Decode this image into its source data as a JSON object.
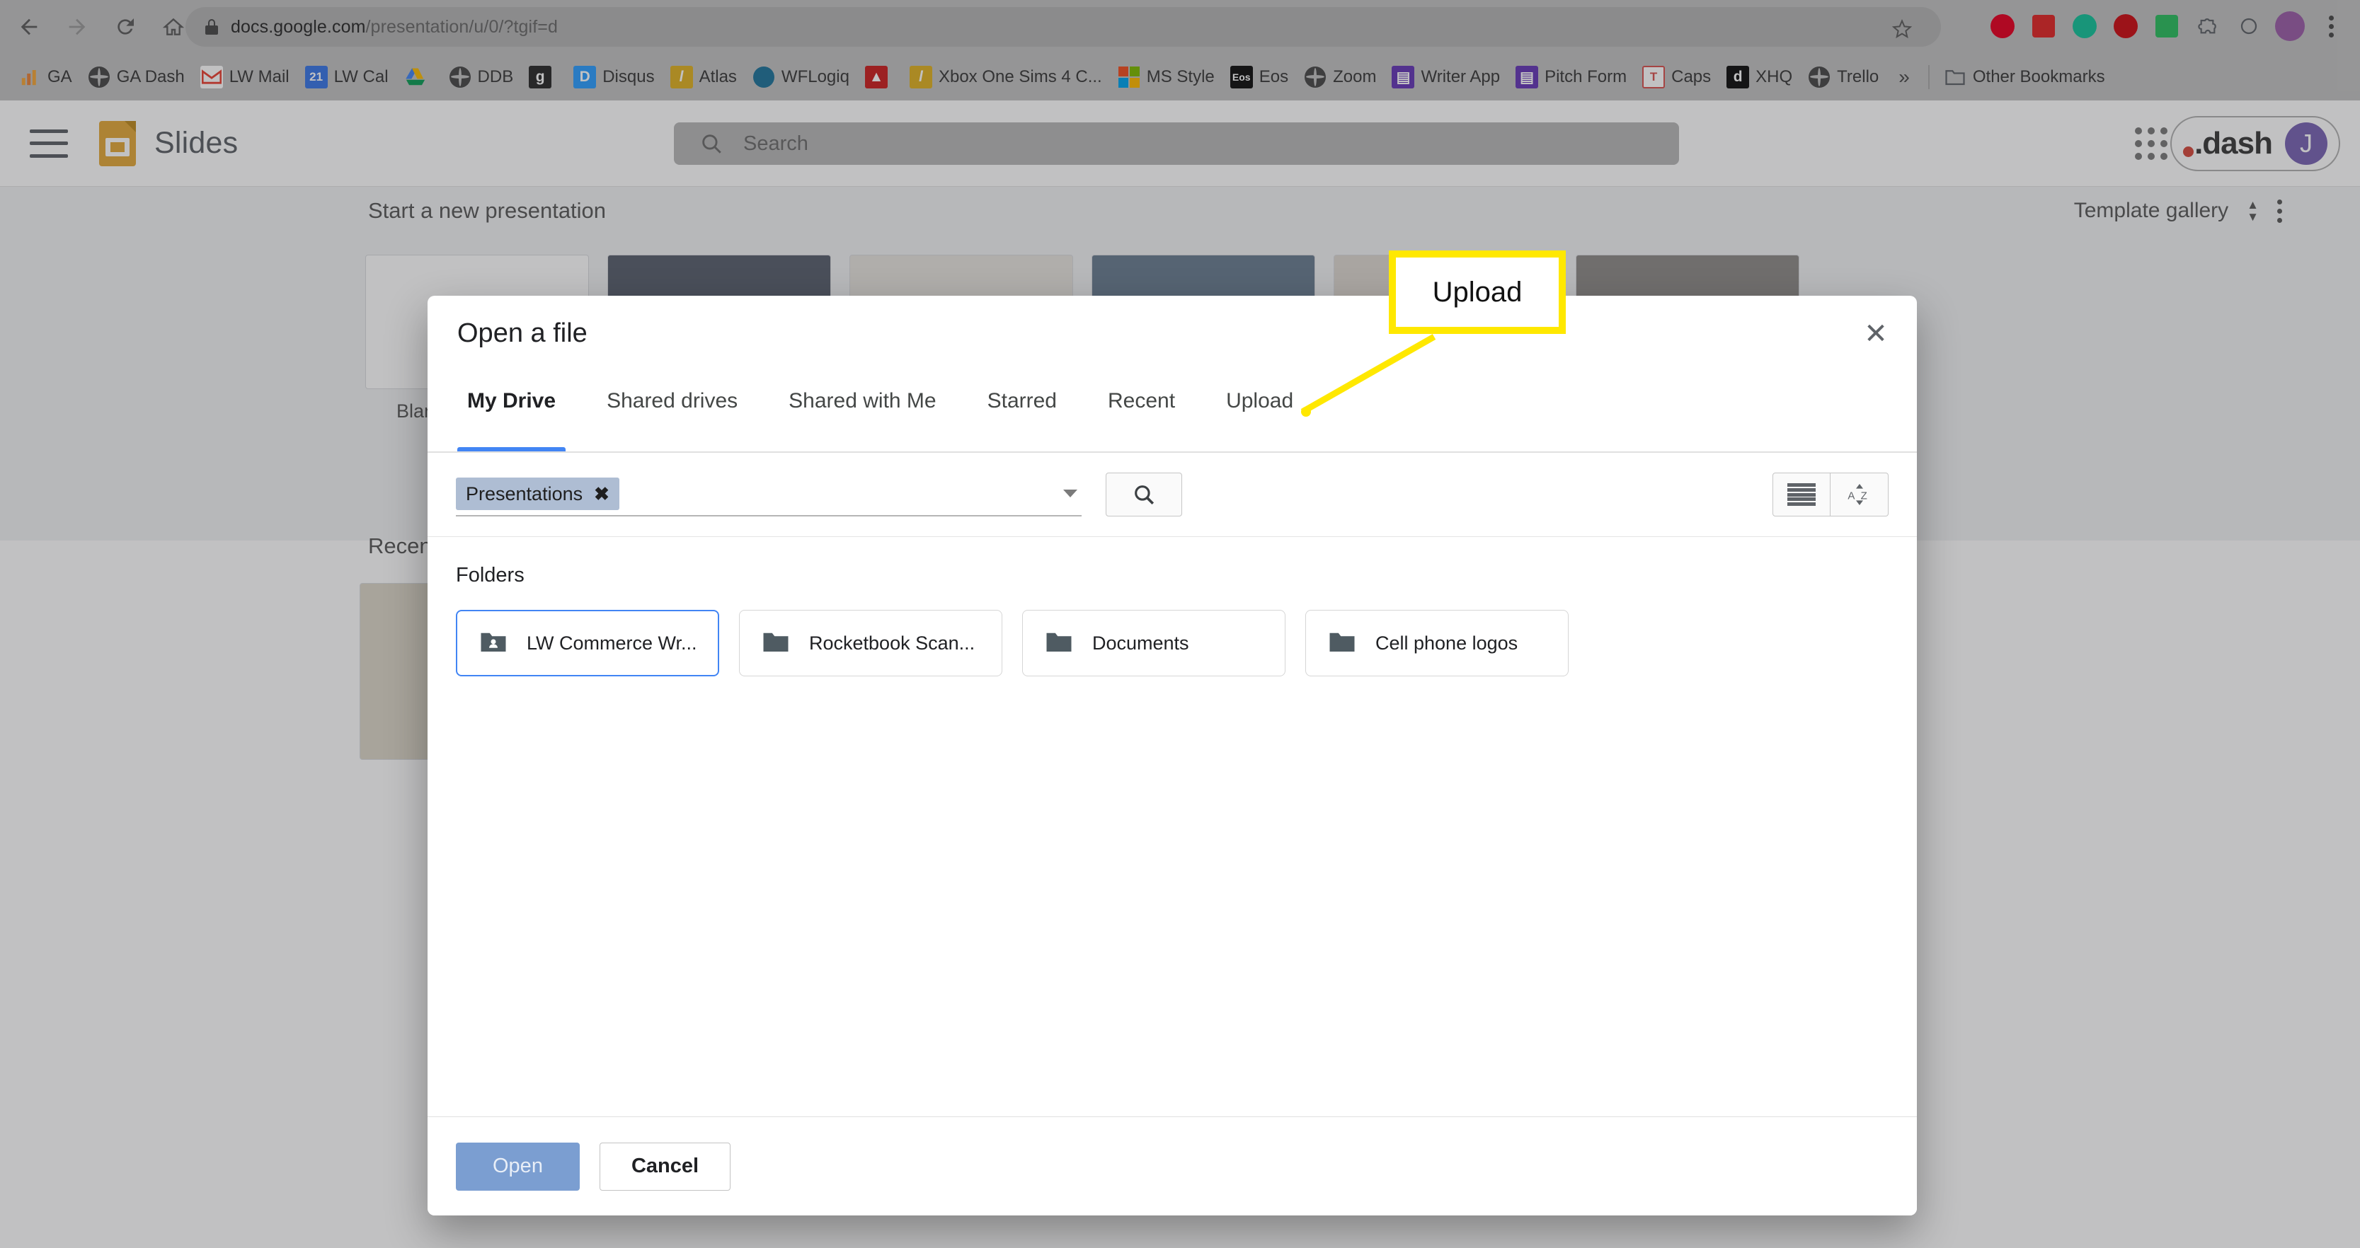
{
  "browser": {
    "url_primary": "docs.google.com",
    "url_rest": "/presentation/u/0/?tgif=d",
    "back_icon": "back-arrow-icon",
    "forward_icon": "forward-arrow-icon",
    "reload_icon": "reload-icon",
    "home_icon": "home-icon",
    "lock_icon": "lock-icon",
    "star_icon": "bookmark-star-icon",
    "bookmarks": [
      {
        "label": "GA",
        "icon": "bar-chart-icon",
        "color": "#f0a020"
      },
      {
        "label": "GA Dash",
        "icon": "globe-icon",
        "color": "#4a4a4a"
      },
      {
        "label": "LW Mail",
        "icon": "gmail-icon",
        "color": "#ea4335"
      },
      {
        "label": "LW Cal",
        "icon": "calendar-icon",
        "color": "#3b78e7"
      },
      {
        "label": "",
        "icon": "google-drive-icon",
        "color": "#0f9d58"
      },
      {
        "label": "DDB",
        "icon": "globe-icon",
        "color": "#4a4a4a"
      },
      {
        "label": "",
        "icon": "g-letter-icon",
        "color": "#2b2b2b"
      },
      {
        "label": "Disqus",
        "icon": "disqus-icon",
        "color": "#2e9fff"
      },
      {
        "label": "Atlas",
        "icon": "l-letter-icon",
        "color": "#e0b224"
      },
      {
        "label": "WFLogiq",
        "icon": "wordpress-icon",
        "color": "#21759b"
      },
      {
        "label": "",
        "icon": "red-site-icon",
        "color": "#cc2222"
      },
      {
        "label": "Xbox One Sims 4 C...",
        "icon": "l-letter-icon",
        "color": "#e0b224"
      },
      {
        "label": "MS Style",
        "icon": "microsoft-icon",
        "color": "#f25022"
      },
      {
        "label": "Eos",
        "icon": "eos-icon",
        "color": "#111111"
      },
      {
        "label": "Zoom",
        "icon": "globe-icon",
        "color": "#4a4a4a"
      },
      {
        "label": "Writer App",
        "icon": "google-forms-icon",
        "color": "#673ab7"
      },
      {
        "label": "Pitch Form",
        "icon": "google-forms-icon",
        "color": "#673ab7"
      },
      {
        "label": "Caps",
        "icon": "t-letter-icon",
        "color": "#d9534f"
      },
      {
        "label": "XHQ",
        "icon": "xhq-icon",
        "color": "#111111"
      },
      {
        "label": "Trello",
        "icon": "globe-icon",
        "color": "#4a4a4a"
      }
    ],
    "overflow_label": "»",
    "other_bookmarks_label": "Other Bookmarks",
    "other_bookmarks_icon": "folder-icon",
    "extensions": [
      {
        "name": "pinterest-extension-icon",
        "color": "#e60023"
      },
      {
        "name": "flipboard-extension-icon",
        "color": "#e12828"
      },
      {
        "name": "grammarly-extension-icon",
        "color": "#15c39a"
      },
      {
        "name": "opera-extension-icon",
        "color": "#cc0f16"
      },
      {
        "name": "evernote-extension-icon",
        "color": "#2dbe60"
      },
      {
        "name": "puzzle-extensions-icon",
        "color": "#5f6368"
      },
      {
        "name": "sync-extension-icon",
        "color": "#5f6368"
      },
      {
        "name": "profile-avatar-icon",
        "color": "#9c5fa8"
      },
      {
        "name": "chrome-menu-icon",
        "color": "#5f6368"
      }
    ]
  },
  "slides": {
    "menu_icon": "hamburger-menu-icon",
    "logo_icon": "google-slides-logo-icon",
    "product_name": "Slides",
    "search": {
      "placeholder": "Search",
      "icon": "search-icon"
    },
    "apps_icon": "google-apps-grid-icon",
    "dash_label": ".dash",
    "avatar_initial": "J",
    "new_presentation_title": "Start a new presentation",
    "template_gallery_label": "Template gallery",
    "template_gallery_icon": "chevron-updown-icon",
    "more_icon": "kebab-menu-icon",
    "blank_label": "Blank",
    "recent_title": "Recent"
  },
  "dialog": {
    "title": "Open a file",
    "close_icon": "close-icon",
    "tabs": [
      {
        "label": "My Drive",
        "active": true
      },
      {
        "label": "Shared drives",
        "active": false
      },
      {
        "label": "Shared with Me",
        "active": false
      },
      {
        "label": "Starred",
        "active": false
      },
      {
        "label": "Recent",
        "active": false
      },
      {
        "label": "Upload",
        "active": false
      }
    ],
    "filter": {
      "chip_label": "Presentations",
      "chip_remove_icon": "close-x-icon",
      "dropdown_icon": "chevron-down-icon",
      "search_button_icon": "search-icon",
      "list_view_icon": "list-view-icon",
      "sort_icon": "sort-az-icon"
    },
    "folders_section_label": "Folders",
    "folders": [
      {
        "name": "LW Commerce Wr...",
        "icon": "shared-folder-icon",
        "selected": true
      },
      {
        "name": "Rocketbook Scan...",
        "icon": "folder-icon",
        "selected": false
      },
      {
        "name": "Documents",
        "icon": "folder-icon",
        "selected": false
      },
      {
        "name": "Cell phone logos",
        "icon": "folder-icon",
        "selected": false
      }
    ],
    "open_label": "Open",
    "cancel_label": "Cancel"
  },
  "annotation": {
    "callout_label": "Upload",
    "border_color": "#ffe800"
  }
}
